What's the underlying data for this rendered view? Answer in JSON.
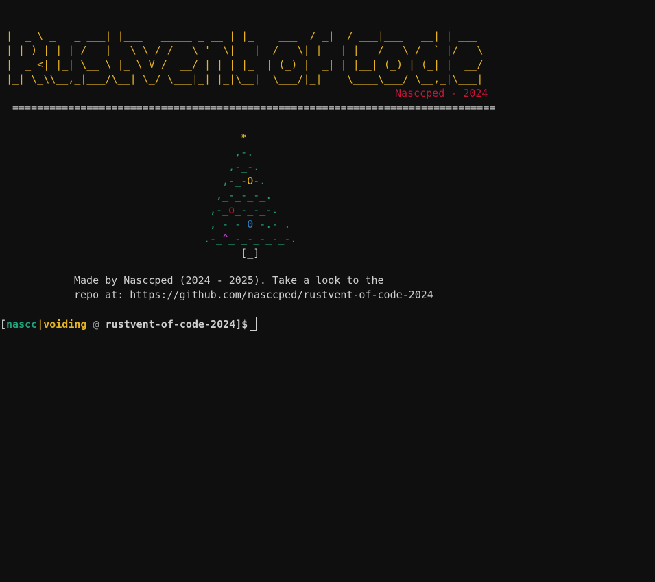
{
  "banner": {
    "lines": [
      " ____        _                                _         ___   ____          _",
      "|  _ \\ _   _ ___| |___   _____ _ __ | |_    ___  / _|  / ___|___   __| | ___",
      "| |_) | | | / __| __\\ \\ / / _ \\ '_ \\| __|  / _ \\| |_  | |   / _ \\ / _` |/ _ \\",
      "|  _ <| |_| \\__ \\ |_ \\ V /  __/ | | | |_  | (_) |  _| | |__| (_) | (_| |  __/",
      "|_| \\_\\\\__,_|___/\\__| \\_/ \\___|_| |_|\\__|  \\___/|_|    \\____\\___/ \\__,_|\\___|"
    ],
    "author": "Nasccped - 2024",
    "rule": "=============================================================================="
  },
  "tree": {
    "star": "*",
    "rows": [
      [
        {
          "t": "     ,-.",
          "c": ""
        }
      ],
      [
        {
          "t": "    ,-_-.",
          "c": ""
        }
      ],
      [
        {
          "t": "   ,-_-",
          "c": ""
        },
        {
          "t": "O",
          "c": "y"
        },
        {
          "t": "-.",
          "c": ""
        }
      ],
      [
        {
          "t": "  ,_-_-_-_.",
          "c": ""
        }
      ],
      [
        {
          "t": " ,-_",
          "c": ""
        },
        {
          "t": "o",
          "c": "r"
        },
        {
          "t": "_-_-_-.",
          "c": ""
        }
      ],
      [
        {
          "t": " ,_-_-_",
          "c": ""
        },
        {
          "t": "0",
          "c": "b"
        },
        {
          "t": "_-.-_.",
          "c": ""
        }
      ],
      [
        {
          "t": ".-_",
          "c": ""
        },
        {
          "t": "^",
          "c": "m"
        },
        {
          "t": "_-_-_-_-_-.",
          "c": ""
        }
      ]
    ],
    "trunk": "[_]"
  },
  "credit": {
    "line1": "Made by Nasccped (2024 - 2025). Take a look to the",
    "line2": "repo at: https://github.com/nasccped/rustvent-of-code-2024"
  },
  "prompt": {
    "open_bracket": "[",
    "user": "nascc",
    "separator": "|",
    "host": "voiding",
    "at_symbol": "@",
    "directory": "rustvent-of-code-2024",
    "close": "]$"
  }
}
